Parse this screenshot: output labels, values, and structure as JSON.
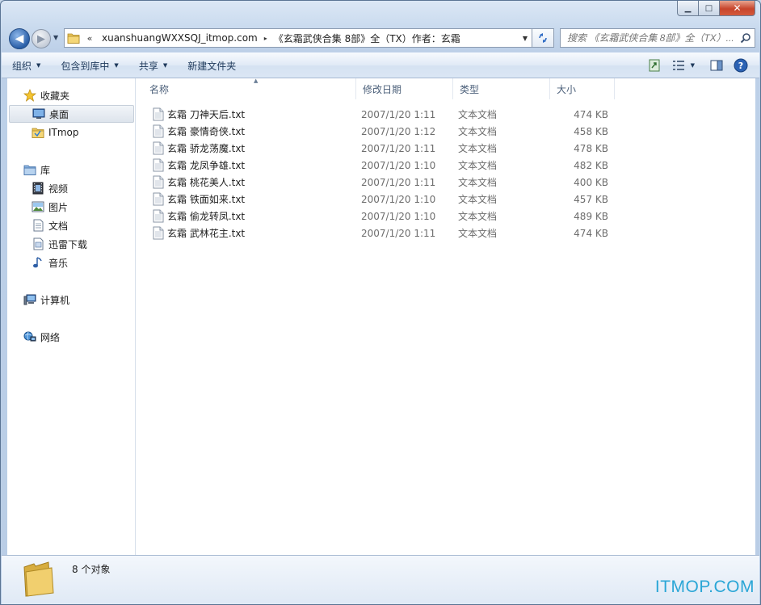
{
  "window": {
    "caption_buttons": {
      "minimize": "▁",
      "maximize": "□",
      "close": "✕"
    }
  },
  "nav": {
    "back_glyph": "◀",
    "forward_glyph": "▶",
    "address": {
      "overflow": "«",
      "segments": [
        "xuanshuangWXXSQJ_itmop.com",
        "《玄霜武侠合集 8部》全（TX）作者：玄霜"
      ],
      "separator": "▸"
    },
    "search": {
      "placeholder": "搜索 《玄霜武侠合集 8部》全（TX）..."
    }
  },
  "toolbar": {
    "organize": "组织",
    "include_in_library": "包含到库中",
    "share": "共享",
    "new_folder": "新建文件夹"
  },
  "sidebar": {
    "favorites": "收藏夹",
    "desktop": "桌面",
    "itmop": "ITmop",
    "libraries": "库",
    "videos": "视频",
    "pictures": "图片",
    "documents": "文档",
    "xunlei": "迅雷下载",
    "music": "音乐",
    "computer": "计算机",
    "network": "网络"
  },
  "columns": {
    "name": "名称",
    "date": "修改日期",
    "type": "类型",
    "size": "大小"
  },
  "files": [
    {
      "name": "玄霜 刀神天后.txt",
      "date": "2007/1/20 1:11",
      "type": "文本文档",
      "size": "474 KB"
    },
    {
      "name": "玄霜 豪情奇侠.txt",
      "date": "2007/1/20 1:12",
      "type": "文本文档",
      "size": "458 KB"
    },
    {
      "name": "玄霜 骄龙荡魔.txt",
      "date": "2007/1/20 1:11",
      "type": "文本文档",
      "size": "478 KB"
    },
    {
      "name": "玄霜 龙凤争雄.txt",
      "date": "2007/1/20 1:10",
      "type": "文本文档",
      "size": "482 KB"
    },
    {
      "name": "玄霜 桃花美人.txt",
      "date": "2007/1/20 1:11",
      "type": "文本文档",
      "size": "400 KB"
    },
    {
      "name": "玄霜 铁面如来.txt",
      "date": "2007/1/20 1:10",
      "type": "文本文档",
      "size": "457 KB"
    },
    {
      "name": "玄霜 偷龙转凤.txt",
      "date": "2007/1/20 1:10",
      "type": "文本文档",
      "size": "489 KB"
    },
    {
      "name": "玄霜 武林花主.txt",
      "date": "2007/1/20 1:11",
      "type": "文本文档",
      "size": "474 KB"
    }
  ],
  "status": {
    "item_count": "8 个对象"
  },
  "watermark": "ITMOP.COM"
}
